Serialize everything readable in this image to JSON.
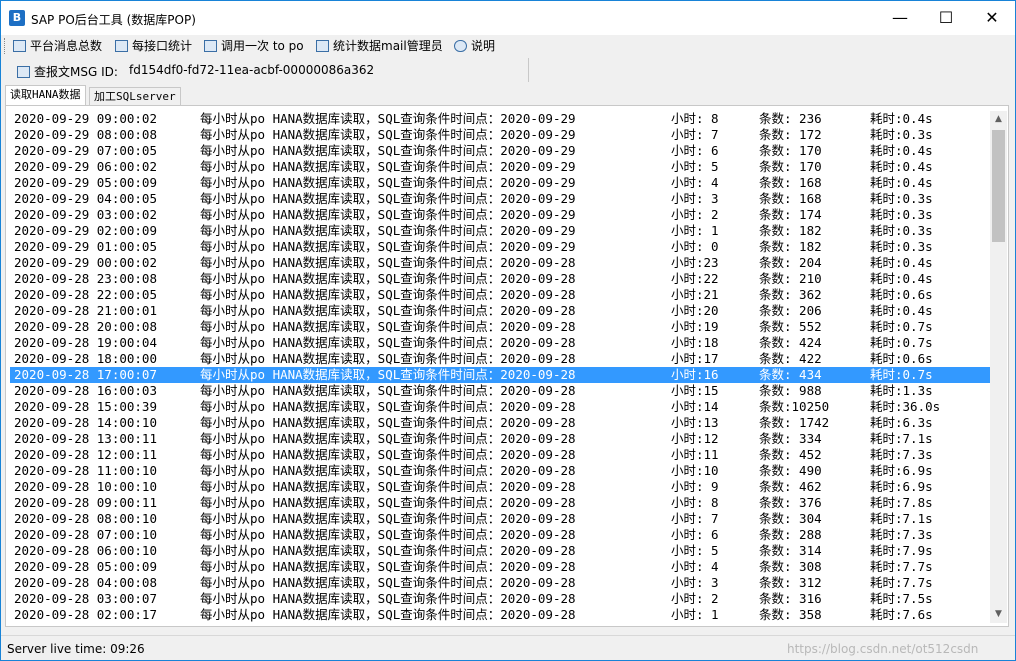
{
  "window": {
    "title": "SAP PO后台工具 (数据库POP)",
    "icon": "app-b-icon"
  },
  "toolbar": {
    "items": [
      {
        "label": "平台消息总数",
        "icon": "grid-icon"
      },
      {
        "label": "每接口统计",
        "icon": "grid-icon"
      },
      {
        "label": "调用一次 to po",
        "icon": "image-icon"
      },
      {
        "label": "统计数据mail管理员",
        "icon": "mail-icon"
      },
      {
        "label": "说明",
        "icon": "help-icon"
      }
    ]
  },
  "msgid": {
    "label": "查报文MSG ID:",
    "value": "fd154df0-fd72-11ea-acbf-00000086a362"
  },
  "tabs": [
    {
      "label": "读取HANA数据",
      "active": true
    },
    {
      "label": "加工SQLserver",
      "active": false
    }
  ],
  "log": {
    "message": "每小时从po HANA数据库读取，SQL查询条件时间点：",
    "selected_index": 16,
    "selection_color": "#3399ff",
    "rows": [
      {
        "ts": "2020-09-29 09:00:02",
        "date": "2020-09-29",
        "hour": "小时: 8",
        "count": "条数:  236",
        "time": "耗时:0.4s"
      },
      {
        "ts": "2020-09-29 08:00:08",
        "date": "2020-09-29",
        "hour": "小时: 7",
        "count": "条数:  172",
        "time": "耗时:0.3s"
      },
      {
        "ts": "2020-09-29 07:00:05",
        "date": "2020-09-29",
        "hour": "小时: 6",
        "count": "条数:  170",
        "time": "耗时:0.4s"
      },
      {
        "ts": "2020-09-29 06:00:02",
        "date": "2020-09-29",
        "hour": "小时: 5",
        "count": "条数:  170",
        "time": "耗时:0.4s"
      },
      {
        "ts": "2020-09-29 05:00:09",
        "date": "2020-09-29",
        "hour": "小时: 4",
        "count": "条数:  168",
        "time": "耗时:0.4s"
      },
      {
        "ts": "2020-09-29 04:00:05",
        "date": "2020-09-29",
        "hour": "小时: 3",
        "count": "条数:  168",
        "time": "耗时:0.3s"
      },
      {
        "ts": "2020-09-29 03:00:02",
        "date": "2020-09-29",
        "hour": "小时: 2",
        "count": "条数:  174",
        "time": "耗时:0.3s"
      },
      {
        "ts": "2020-09-29 02:00:09",
        "date": "2020-09-29",
        "hour": "小时: 1",
        "count": "条数:  182",
        "time": "耗时:0.3s"
      },
      {
        "ts": "2020-09-29 01:00:05",
        "date": "2020-09-29",
        "hour": "小时: 0",
        "count": "条数:  182",
        "time": "耗时:0.3s"
      },
      {
        "ts": "2020-09-29 00:00:02",
        "date": "2020-09-28",
        "hour": "小时:23",
        "count": "条数:  204",
        "time": "耗时:0.4s"
      },
      {
        "ts": "2020-09-28 23:00:08",
        "date": "2020-09-28",
        "hour": "小时:22",
        "count": "条数:  210",
        "time": "耗时:0.4s"
      },
      {
        "ts": "2020-09-28 22:00:05",
        "date": "2020-09-28",
        "hour": "小时:21",
        "count": "条数:  362",
        "time": "耗时:0.6s"
      },
      {
        "ts": "2020-09-28 21:00:01",
        "date": "2020-09-28",
        "hour": "小时:20",
        "count": "条数:  206",
        "time": "耗时:0.4s"
      },
      {
        "ts": "2020-09-28 20:00:08",
        "date": "2020-09-28",
        "hour": "小时:19",
        "count": "条数:  552",
        "time": "耗时:0.7s"
      },
      {
        "ts": "2020-09-28 19:00:04",
        "date": "2020-09-28",
        "hour": "小时:18",
        "count": "条数:  424",
        "time": "耗时:0.7s"
      },
      {
        "ts": "2020-09-28 18:00:00",
        "date": "2020-09-28",
        "hour": "小时:17",
        "count": "条数:  422",
        "time": "耗时:0.6s"
      },
      {
        "ts": "2020-09-28 17:00:07",
        "date": "2020-09-28",
        "hour": "小时:16",
        "count": "条数:  434",
        "time": "耗时:0.7s"
      },
      {
        "ts": "2020-09-28 16:00:03",
        "date": "2020-09-28",
        "hour": "小时:15",
        "count": "条数:  988",
        "time": "耗时:1.3s"
      },
      {
        "ts": "2020-09-28 15:00:39",
        "date": "2020-09-28",
        "hour": "小时:14",
        "count": "条数:10250",
        "time": "耗时:36.0s"
      },
      {
        "ts": "2020-09-28 14:00:10",
        "date": "2020-09-28",
        "hour": "小时:13",
        "count": "条数: 1742",
        "time": "耗时:6.3s"
      },
      {
        "ts": "2020-09-28 13:00:11",
        "date": "2020-09-28",
        "hour": "小时:12",
        "count": "条数:  334",
        "time": "耗时:7.1s"
      },
      {
        "ts": "2020-09-28 12:00:11",
        "date": "2020-09-28",
        "hour": "小时:11",
        "count": "条数:  452",
        "time": "耗时:7.3s"
      },
      {
        "ts": "2020-09-28 11:00:10",
        "date": "2020-09-28",
        "hour": "小时:10",
        "count": "条数:  490",
        "time": "耗时:6.9s"
      },
      {
        "ts": "2020-09-28 10:00:10",
        "date": "2020-09-28",
        "hour": "小时: 9",
        "count": "条数:  462",
        "time": "耗时:6.9s"
      },
      {
        "ts": "2020-09-28 09:00:11",
        "date": "2020-09-28",
        "hour": "小时: 8",
        "count": "条数:  376",
        "time": "耗时:7.8s"
      },
      {
        "ts": "2020-09-28 08:00:10",
        "date": "2020-09-28",
        "hour": "小时: 7",
        "count": "条数:  304",
        "time": "耗时:7.1s"
      },
      {
        "ts": "2020-09-28 07:00:10",
        "date": "2020-09-28",
        "hour": "小时: 6",
        "count": "条数:  288",
        "time": "耗时:7.3s"
      },
      {
        "ts": "2020-09-28 06:00:10",
        "date": "2020-09-28",
        "hour": "小时: 5",
        "count": "条数:  314",
        "time": "耗时:7.9s"
      },
      {
        "ts": "2020-09-28 05:00:09",
        "date": "2020-09-28",
        "hour": "小时: 4",
        "count": "条数:  308",
        "time": "耗时:7.7s"
      },
      {
        "ts": "2020-09-28 04:00:08",
        "date": "2020-09-28",
        "hour": "小时: 3",
        "count": "条数:  312",
        "time": "耗时:7.7s"
      },
      {
        "ts": "2020-09-28 03:00:07",
        "date": "2020-09-28",
        "hour": "小时: 2",
        "count": "条数:  316",
        "time": "耗时:7.5s"
      },
      {
        "ts": "2020-09-28 02:00:17",
        "date": "2020-09-28",
        "hour": "小时: 1",
        "count": "条数:  358",
        "time": "耗时:7.6s"
      }
    ]
  },
  "status": {
    "text": "Server live time: 09:26",
    "watermark": "https://blog.csdn.net/ot512csdn"
  }
}
